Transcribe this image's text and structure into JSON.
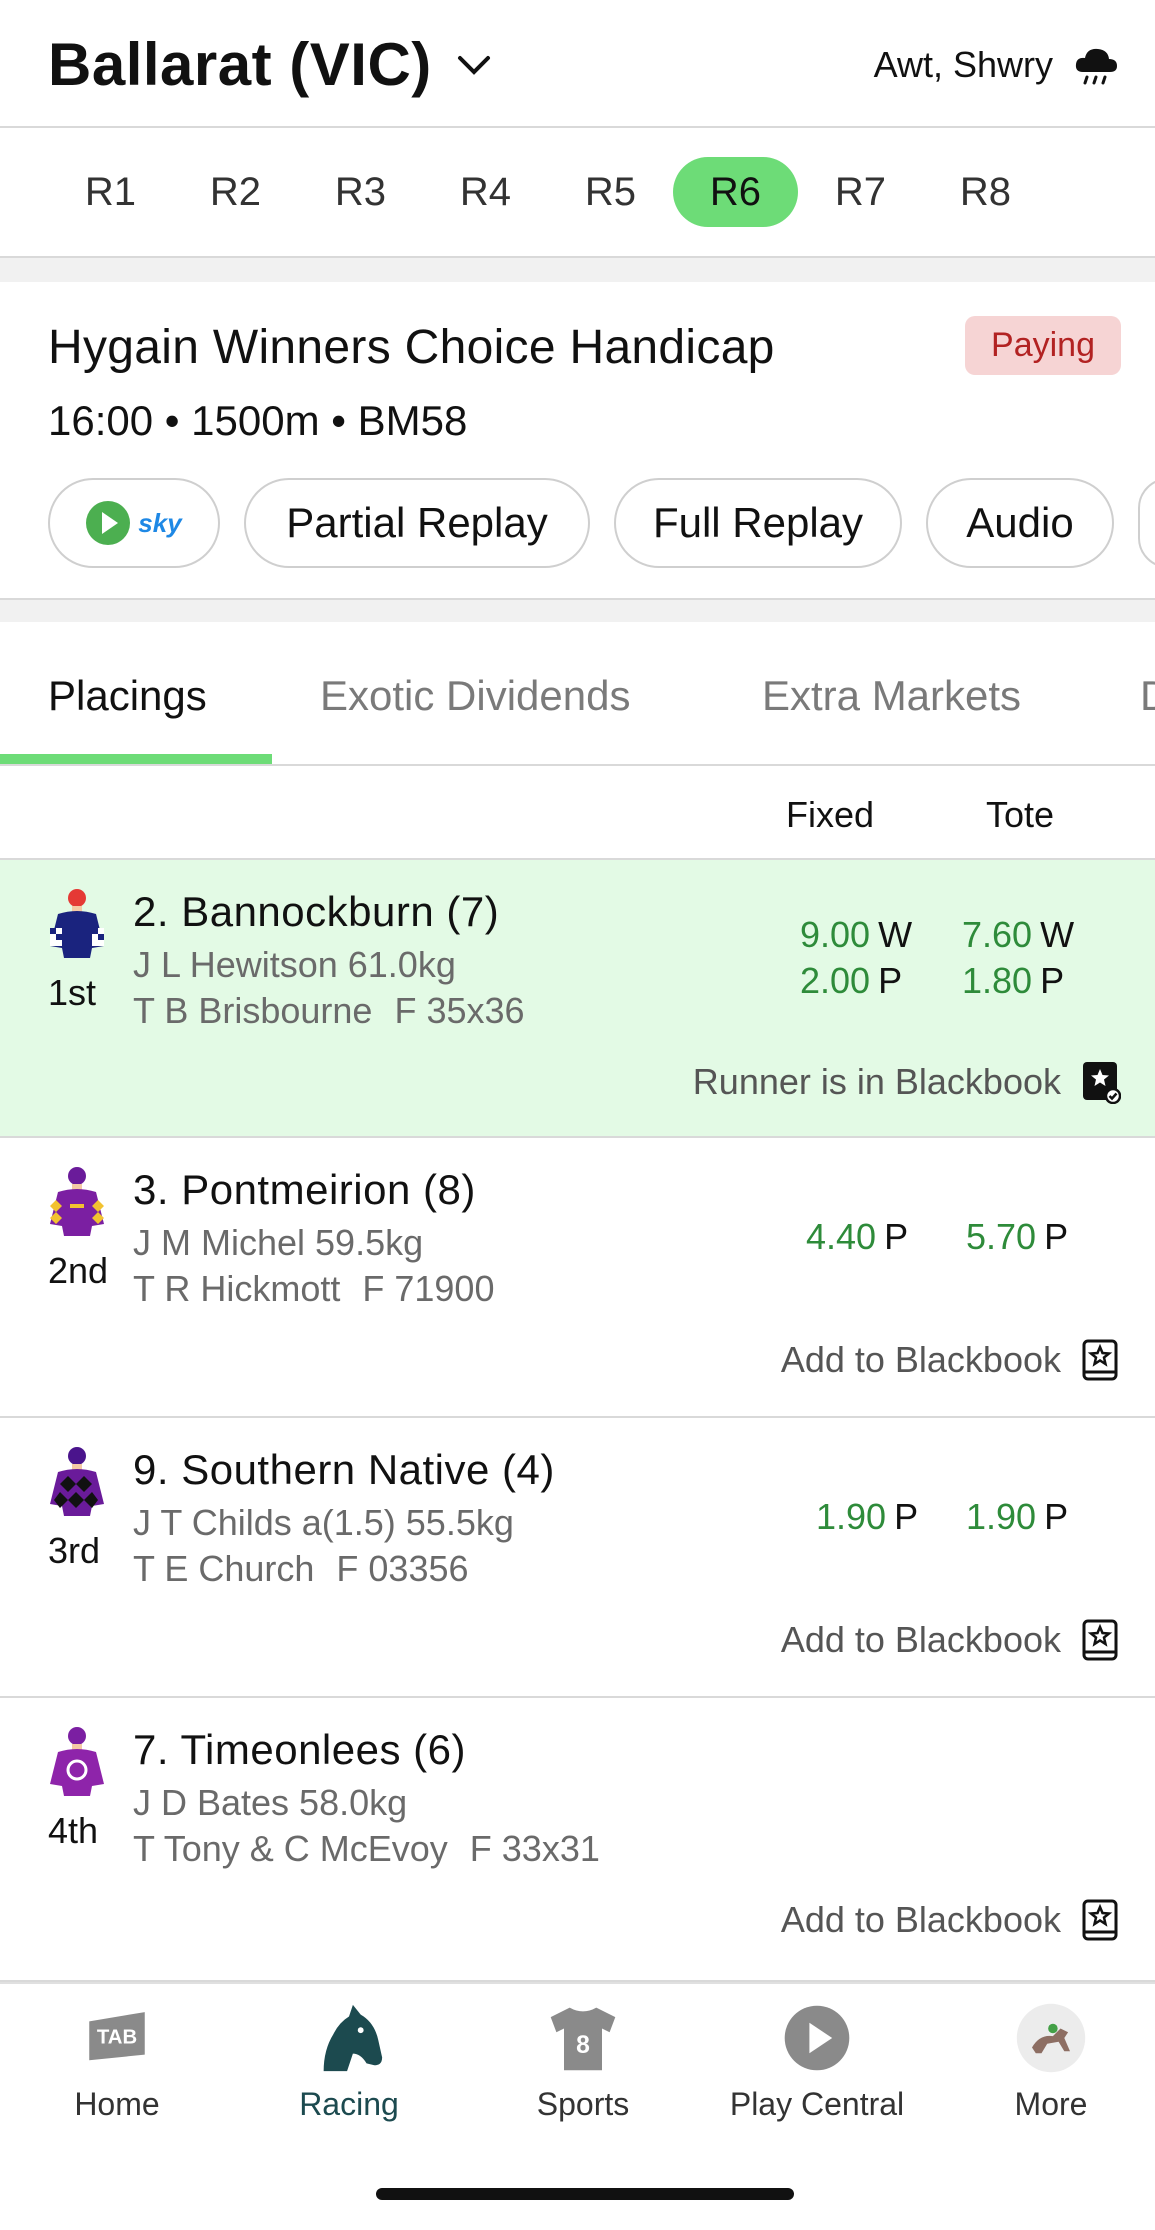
{
  "header": {
    "venue": "Ballarat (VIC)",
    "weather": "Awt, Shwry",
    "weather_icon": "rain-cloud-icon"
  },
  "race_tabs": [
    "R1",
    "R2",
    "R3",
    "R4",
    "R5",
    "R6",
    "R7",
    "R8"
  ],
  "active_race": "R6",
  "race": {
    "name": "Hygain Winners Choice Handicap",
    "status": "Paying",
    "meta": "16:00 • 1500m • BM58",
    "media_buttons": {
      "stream_logo": "sky",
      "partial_replay": "Partial Replay",
      "full_replay": "Full Replay",
      "audio": "Audio"
    }
  },
  "result_tabs": [
    "Placings",
    "Exotic Dividends",
    "Extra Markets",
    "D"
  ],
  "columns": {
    "fixed": "Fixed",
    "tote": "Tote"
  },
  "runners": [
    {
      "place": "1st",
      "name": "2. Bannockburn (7)",
      "jockey": "J L Hewitson 61.0kg",
      "trainer": "T B Brisbourne",
      "form": "F 35x36",
      "fixed_win": "9.00",
      "fixed_place": "2.00",
      "tote_win": "7.60",
      "tote_place": "1.80",
      "win_label": "W",
      "place_label": "P",
      "blackbook": "Runner is in Blackbook"
    },
    {
      "place": "2nd",
      "name": "3. Pontmeirion (8)",
      "jockey": "J M Michel 59.5kg",
      "trainer": "T R Hickmott",
      "form": "F 71900",
      "fixed_place": "4.40",
      "tote_place": "5.70",
      "place_label": "P",
      "blackbook": "Add to Blackbook"
    },
    {
      "place": "3rd",
      "name": "9. Southern Native (4)",
      "jockey": "J T Childs a(1.5) 55.5kg",
      "trainer": "T E Church",
      "form": "F 03356",
      "fixed_place": "1.90",
      "tote_place": "1.90",
      "place_label": "P",
      "blackbook": "Add to Blackbook"
    },
    {
      "place": "4th",
      "name": "7. Timeonlees (6)",
      "jockey": "J D Bates 58.0kg",
      "trainer": "T Tony & C McEvoy",
      "form": "F 33x31",
      "blackbook": "Add to Blackbook"
    }
  ],
  "bottom_nav": [
    {
      "label": "Home",
      "icon": "tab-logo-icon"
    },
    {
      "label": "Racing",
      "icon": "horse-head-icon",
      "active": true
    },
    {
      "label": "Sports",
      "icon": "jersey-icon",
      "badge": "8"
    },
    {
      "label": "Play Central",
      "icon": "play-circle-icon"
    },
    {
      "label": "More",
      "icon": "avatar-horse-icon"
    }
  ],
  "colors": {
    "accent_green": "#6ddc77",
    "odds_green": "#2e8b3a",
    "winner_bg": "#e3fae5",
    "paying_bg": "#f6d4d4",
    "paying_text": "#b22222",
    "racing_active": "#1c4a4f"
  }
}
